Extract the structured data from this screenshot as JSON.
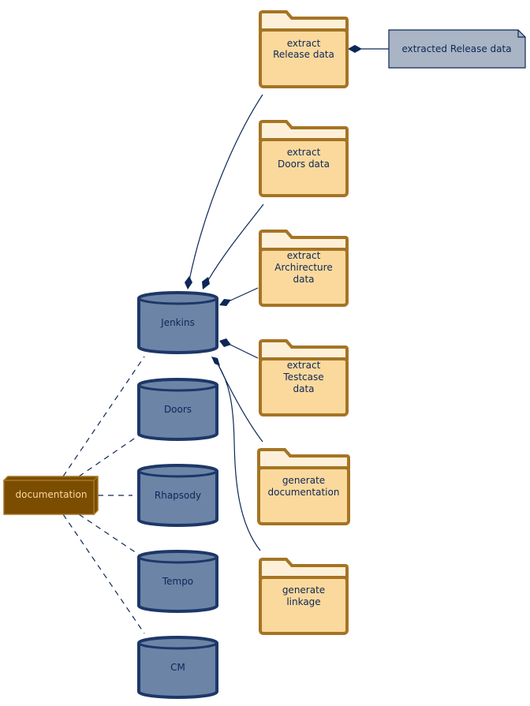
{
  "folders": [
    {
      "lines": [
        "extract",
        "Release data"
      ]
    },
    {
      "lines": [
        "extract",
        "Doors data"
      ]
    },
    {
      "lines": [
        "extract",
        "Archirecture",
        "data"
      ]
    },
    {
      "lines": [
        "extract",
        "Testcase",
        "data"
      ]
    },
    {
      "lines": [
        "generate",
        "documentation"
      ]
    },
    {
      "lines": [
        "generate",
        "linkage"
      ]
    }
  ],
  "databases": [
    "Jenkins",
    "Doors",
    "Rhapsody",
    "Tempo",
    "CM"
  ],
  "node": {
    "label": "documentation"
  },
  "note": {
    "label": "extracted Release data"
  },
  "colors": {
    "folder_fill": "#fbd99d",
    "folder_border": "#a57424",
    "database_fill": "#6c84a6",
    "database_border": "#1d3767",
    "node_fill": "#7a4d00",
    "note_fill": "#a9b4c5",
    "edge": "#0d2757"
  }
}
